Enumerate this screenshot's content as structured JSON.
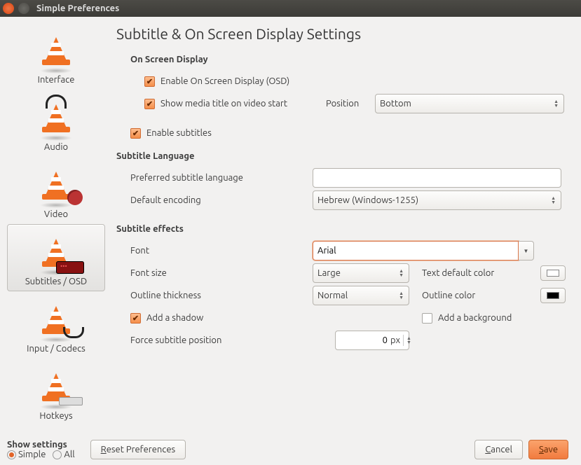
{
  "window": {
    "title": "Simple Preferences"
  },
  "sidebar": {
    "items": [
      {
        "label": "Interface"
      },
      {
        "label": "Audio"
      },
      {
        "label": "Video"
      },
      {
        "label": "Subtitles / OSD"
      },
      {
        "label": "Input / Codecs"
      },
      {
        "label": "Hotkeys"
      }
    ],
    "selected": 3
  },
  "page": {
    "title": "Subtitle & On Screen Display Settings",
    "osd": {
      "heading": "On Screen Display",
      "enable_osd": "Enable On Screen Display (OSD)",
      "show_title": "Show media title on video start",
      "position_label": "Position",
      "position_value": "Bottom"
    },
    "enable_subtitles": "Enable subtitles",
    "lang": {
      "heading": "Subtitle Language",
      "pref_label": "Preferred subtitle language",
      "pref_value": "",
      "enc_label": "Default encoding",
      "enc_value": "Hebrew (Windows-1255)"
    },
    "fx": {
      "heading": "Subtitle effects",
      "font_label": "Font",
      "font_value": "Arial",
      "size_label": "Font size",
      "size_value": "Large",
      "textcolor_label": "Text default color",
      "textcolor_value": "#ffffff",
      "outline_label": "Outline thickness",
      "outline_value": "Normal",
      "outcolor_label": "Outline color",
      "outcolor_value": "#000000",
      "shadow_label": "Add a shadow",
      "bg_label": "Add a background",
      "force_label": "Force subtitle position",
      "force_value": "0",
      "force_unit": "px"
    }
  },
  "footer": {
    "show_settings": "Show settings",
    "simple": "Simple",
    "all": "All",
    "reset": "Reset Preferences",
    "cancel": "Cancel",
    "save": "Save"
  }
}
